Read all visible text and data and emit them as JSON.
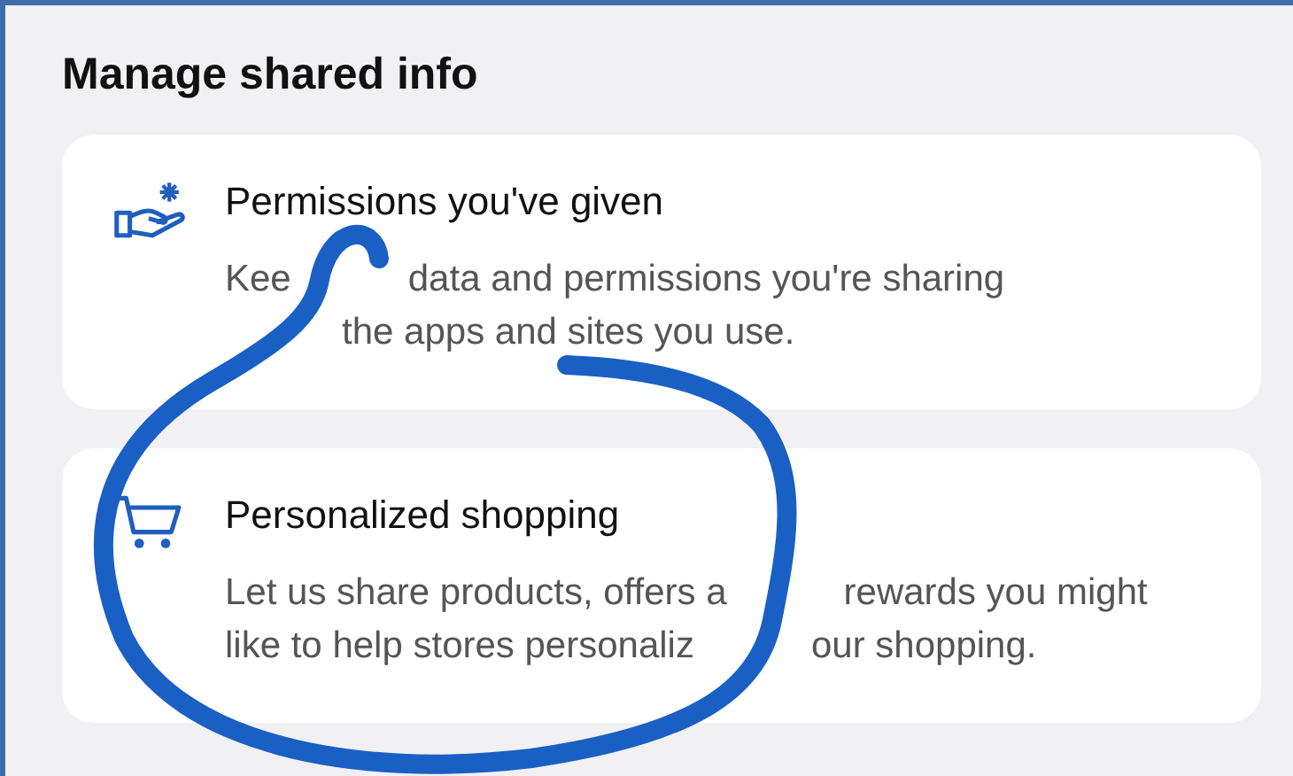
{
  "title": "Manage shared info",
  "cards": [
    {
      "kind": "hand",
      "title": "Permissions you've given",
      "lines": [
        [
          {
            "text": "Kee",
            "gap_before": false
          },
          {
            "text": "data and permissions you're sharing",
            "gap_before": true
          }
        ],
        [
          {
            "text": "the apps and sites you use.",
            "gap_before": true
          }
        ]
      ]
    },
    {
      "kind": "cart",
      "title": "Personalized shopping",
      "lines": [
        [
          {
            "text": "Let us share products, offers a",
            "gap_before": false
          },
          {
            "text": "rewards you might",
            "gap_before": true
          }
        ],
        [
          {
            "text": "like to help stores personaliz",
            "gap_before": false
          },
          {
            "text": "our shopping.",
            "gap_before": true
          }
        ]
      ]
    }
  ]
}
